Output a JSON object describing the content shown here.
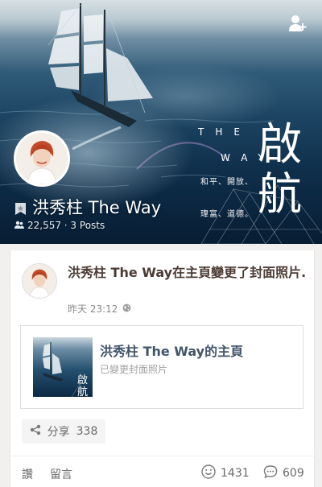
{
  "cover": {
    "page_name": "洪秀柱 The Way",
    "stats": "22,557 · 3 Posts",
    "title_top": "THE",
    "title_bottom": "WAY",
    "slogan_1": "和平、開放、",
    "slogan_2": "瑋富、道德。",
    "big_char_1": "啟",
    "big_char_2": "航"
  },
  "post": {
    "author": "洪秀柱 The Way",
    "action_text": "在主頁變更了封面照片.",
    "time": "昨天 23:12",
    "attachment": {
      "title": "洪秀柱 The Way的主頁",
      "subtitle": "已變更封面照片",
      "thumb_char_1": "啟",
      "thumb_char_2": "航"
    },
    "share": {
      "label": "分享",
      "count": "338"
    },
    "actions": {
      "like": "讚",
      "comment": "留言"
    },
    "reactions": {
      "smile_count": "1431",
      "comment_count": "609"
    }
  },
  "colors": {
    "name_brown": "#4b3b34",
    "link_blue": "#42546b",
    "ocean_deep": "#0f2f4b"
  },
  "icons": {
    "add_user": "add-user-icon",
    "page_badge": "page-badge-icon",
    "people": "people-icon",
    "globe": "globe-icon",
    "share": "share-icon",
    "smile": "smile-icon",
    "comment": "comment-bubble-icon"
  }
}
